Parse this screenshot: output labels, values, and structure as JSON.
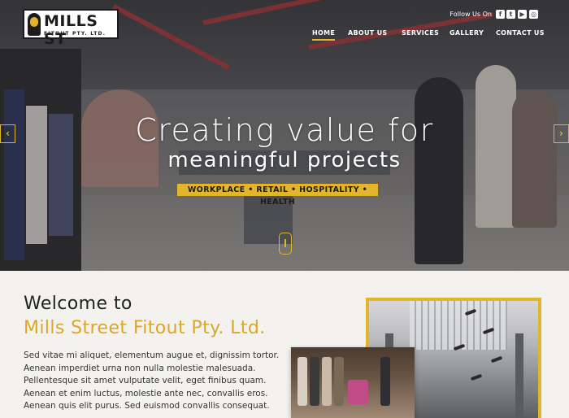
{
  "brand": {
    "logo_name": "MILLS ST",
    "logo_sub": "FITOUT PTY. LTD."
  },
  "header": {
    "follow_label": "Follow Us On",
    "social_icons": [
      "facebook-icon",
      "twitter-icon",
      "youtube-icon",
      "instagram-icon"
    ]
  },
  "nav": {
    "items": [
      {
        "label": "HOME",
        "active": true
      },
      {
        "label": "ABOUT US",
        "active": false
      },
      {
        "label": "SERVICES",
        "active": false
      },
      {
        "label": "GALLERY",
        "active": false
      },
      {
        "label": "CONTACT US",
        "active": false
      }
    ]
  },
  "hero": {
    "title": "Creating value for",
    "subtitle": "meaningful projects",
    "tagline": "WORKPLACE • RETAIL • HOSPITALITY • HEALTH",
    "prev_icon": "chevron-left-icon",
    "next_icon": "chevron-right-icon",
    "prev_symbol": "‹",
    "next_symbol": "›"
  },
  "welcome": {
    "heading": "Welcome to",
    "company": "Mills Street Fitout Pty. Ltd.",
    "body": "Sed vitae mi aliquet, elementum augue et, dignissim tortor. Aenean imperdiet urna non nulla molestie malesuada. Pellentesque sit amet vulputate velit, eget finibus quam. Aenean et enim luctus, molestie ante nec, convallis eros. Aenean quis elit purus. Sed euismod convallis consequat."
  },
  "colors": {
    "accent": "#e2b52d",
    "heading": "#222222",
    "company": "#dba727",
    "background": "#f3f2ee"
  }
}
